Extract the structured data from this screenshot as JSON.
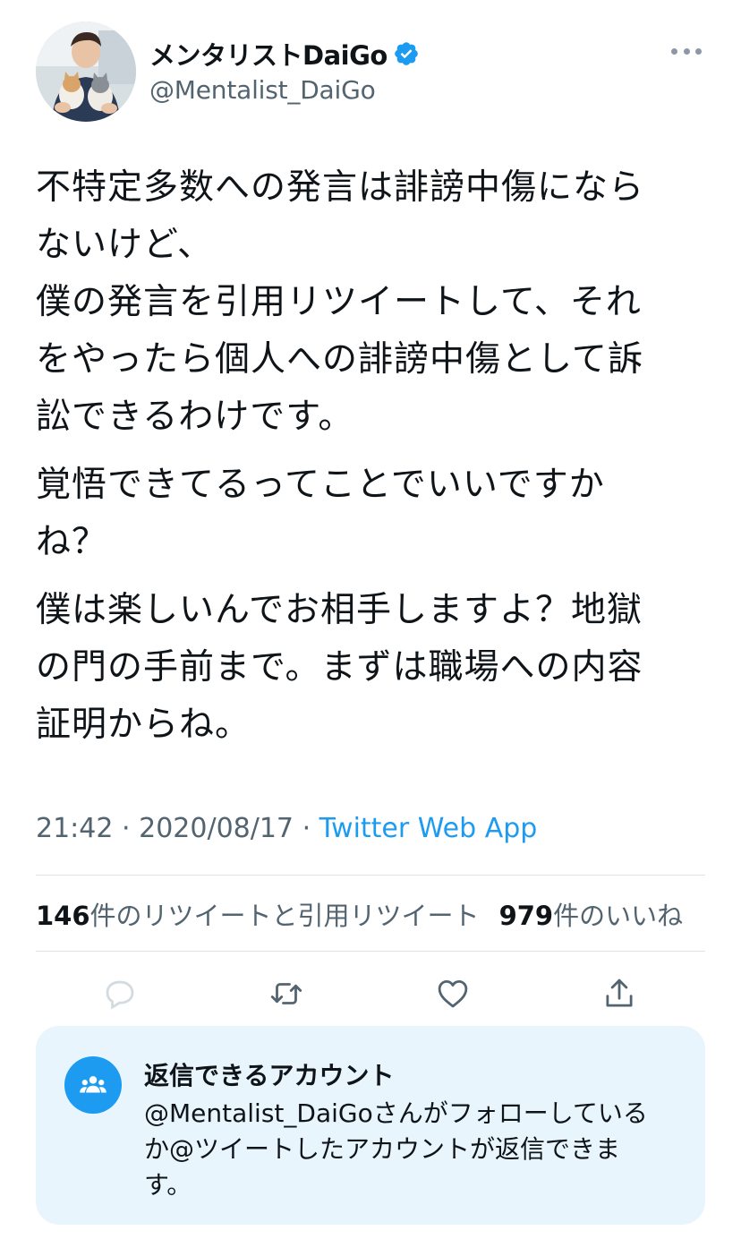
{
  "user": {
    "display_name": "メンタリストDaiGo",
    "handle": "@Mentalist_DaiGo",
    "verified": true,
    "avatar_icon": "profile-photo-with-cats"
  },
  "tweet": {
    "paragraphs": [
      [
        "不特定多数への発言は誹謗中傷になら",
        "ないけど、",
        "僕の発言を引用リツイートして、それ",
        "をやったら個人への誹謗中傷として訴",
        "訟できるわけです。"
      ],
      [
        "覚悟できてるってことでいいですか",
        "ね？"
      ],
      [
        "僕は楽しいんでお相手しますよ？地獄",
        "の門の手前まで。まずは職場への内容",
        "証明からね。"
      ]
    ],
    "time": "21:42",
    "separator": "·",
    "date": "2020/08/17",
    "source": "Twitter Web App"
  },
  "stats": {
    "retweets_count": "146",
    "retweets_label": "件のリツイートと引用リツイート",
    "likes_count": "979",
    "likes_label": "件のいいね"
  },
  "actions": [
    "reply-icon",
    "retweet-icon",
    "like-icon",
    "share-icon"
  ],
  "reply_restriction": {
    "title": "返信できるアカウント",
    "body_lines": [
      "@Mentalist_DaiGoさんがフォローしている",
      "か@ツイートしたアカウントが返信できま",
      "す。"
    ],
    "icon": "people-icon"
  },
  "colors": {
    "accent": "#1d9bf0",
    "secondary_text": "#536471",
    "card_background": "#e8f5fd"
  }
}
